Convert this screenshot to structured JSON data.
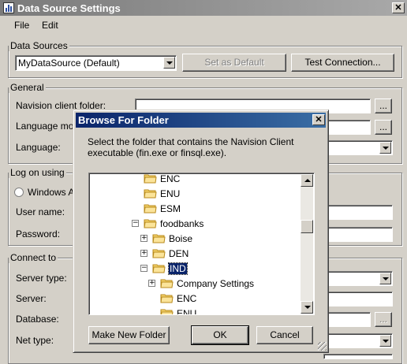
{
  "window": {
    "title": "Data Source Settings",
    "close_glyph": "✕"
  },
  "menu": {
    "file": "File",
    "edit": "Edit"
  },
  "data_sources": {
    "group_label": "Data Sources",
    "selected": "MyDataSource (Default)",
    "set_default_label": "Set as Default",
    "test_connection_label": "Test Connection..."
  },
  "general": {
    "group_label": "General",
    "client_folder_label": "Navision client folder:",
    "language_module_label": "Language mod",
    "language_label": "Language:",
    "browse_label": "..."
  },
  "logon": {
    "group_label": "Log on using",
    "windows_auth_label": "Windows Au",
    "username_label": "User name:",
    "password_label": "Password:"
  },
  "connect": {
    "group_label": "Connect to",
    "server_type_label": "Server type:",
    "server_label": "Server:",
    "database_label": "Database:",
    "net_type_label": "Net type:",
    "browse_label": "..."
  },
  "dialog": {
    "title": "Browse For Folder",
    "close_glyph": "✕",
    "instruction": "Select the folder that contains the Navision Client executable (fin.exe or finsql.exe).",
    "make_new_folder_label": "Make New Folder",
    "ok_label": "OK",
    "cancel_label": "Cancel",
    "tree": [
      {
        "label": "ENC",
        "toggle": ""
      },
      {
        "label": "ENU",
        "toggle": ""
      },
      {
        "label": "ESM",
        "toggle": ""
      },
      {
        "label": "foodbanks",
        "toggle": "−"
      },
      {
        "label": "Boise",
        "toggle": "+"
      },
      {
        "label": "DEN",
        "toggle": "+"
      },
      {
        "label": "IND",
        "toggle": "−",
        "selected": true
      },
      {
        "label": "Company Settings",
        "toggle": "+"
      },
      {
        "label": "ENC",
        "toggle": ""
      },
      {
        "label": "ENU",
        "toggle": ""
      }
    ]
  },
  "colors": {
    "folder_yellow": "#f5d36a",
    "folder_edge": "#b88a1c",
    "selection": "#0a246a"
  }
}
